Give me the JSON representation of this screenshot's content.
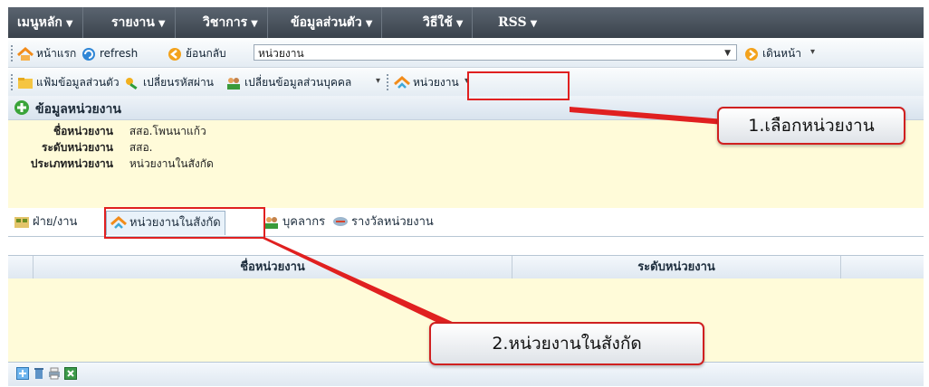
{
  "menubar": {
    "items": [
      {
        "label": "เมนูหลัก",
        "icon": "caret-down-icon"
      },
      {
        "label": "รายงาน",
        "icon": "caret-down-icon"
      },
      {
        "label": "วิชาการ",
        "icon": "caret-down-icon"
      },
      {
        "label": "ข้อมูลส่วนตัว",
        "icon": "caret-down-icon"
      },
      {
        "label": "วิธีใช้",
        "icon": "caret-down-icon"
      },
      {
        "label": "RSS",
        "icon": "caret-down-icon"
      }
    ]
  },
  "nav_toolbar": {
    "home_label": "หน้าแรก",
    "refresh_label": "refresh",
    "back_label": "ย้อนกลับ",
    "location_value": "หน่วยงาน",
    "forward_label": "เดินหน้า"
  },
  "profile_toolbar": {
    "profile_folder_label": "แฟ้มข้อมูลส่วนตัว",
    "change_password_label": "เปลี่ยนรหัสผ่าน",
    "change_personal_label": "เปลี่ยนข้อมูลส่วนบุคคล",
    "unit_label": "หน่วยงาน"
  },
  "panel": {
    "title": "ข้อมูลหน่วยงาน",
    "fields": [
      {
        "label": "ชื่อหน่วยงาน",
        "value": "สสอ.โพนนาแก้ว"
      },
      {
        "label": "ระดับหน่วยงาน",
        "value": "สสอ."
      },
      {
        "label": "ประเภทหน่วยงาน",
        "value": "หน่วยงานในสังกัด"
      }
    ]
  },
  "tabs": [
    {
      "label": "ฝ่าย/งาน",
      "icon": "department-icon"
    },
    {
      "label": "หน่วยงานในสังกัด",
      "icon": "unit-icon"
    },
    {
      "label": "บุคลากร",
      "icon": "people-icon"
    },
    {
      "label": "รางวัลหน่วยงาน",
      "icon": "award-icon"
    }
  ],
  "grid": {
    "columns": [
      "ชื่อหน่วยงาน",
      "ระดับหน่วยงาน"
    ],
    "footer_icons": [
      "add-icon",
      "delete-icon",
      "print-icon",
      "excel-icon"
    ]
  },
  "annotations": {
    "callout1": "1.เลือกหน่วยงาน",
    "callout2": "2.หน่วยงานในสังกัด"
  },
  "colors": {
    "menubar": "#444c55",
    "info_background": "#fffbd9",
    "highlight": "#e02020"
  }
}
